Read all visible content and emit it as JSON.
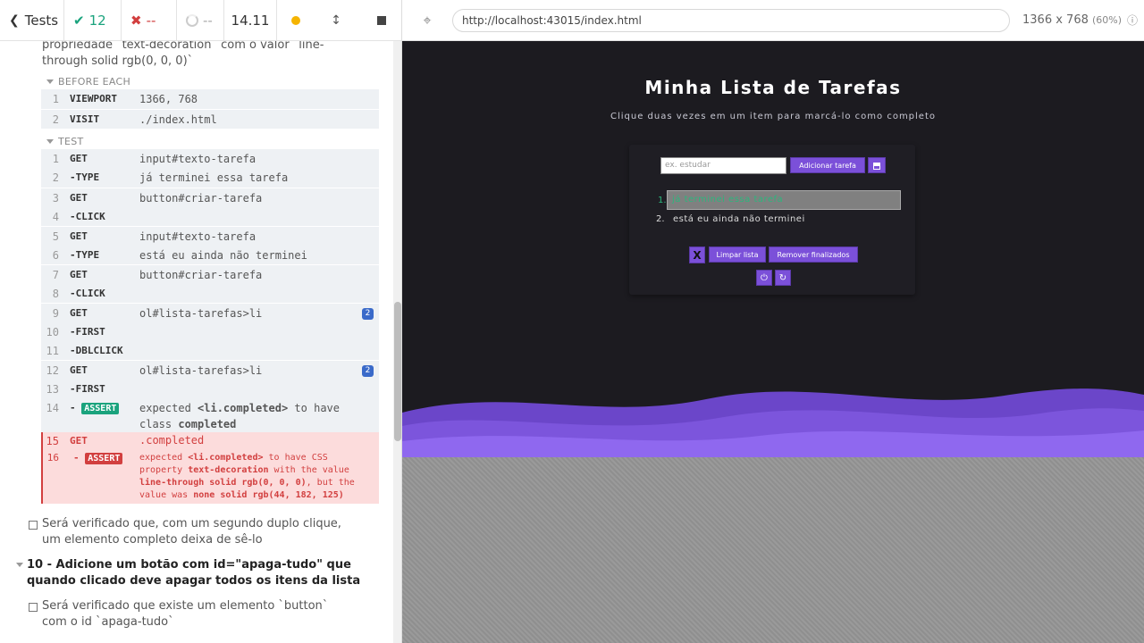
{
  "reporter": {
    "tests_label": "Tests",
    "passed": "12",
    "failed": "--",
    "pending": "--",
    "duration": "14.11",
    "test_title_partial": "propriedade `text-decoration` com o valor `line-through solid rgb(0, 0, 0)`",
    "before_each_label": "BEFORE EACH",
    "test_label": "TEST",
    "before_each_commands": [
      {
        "num": "1",
        "name": "VIEWPORT",
        "msg": "1366, 768"
      },
      {
        "num": "2",
        "name": "VISIT",
        "msg": "./index.html"
      }
    ],
    "test_commands": [
      {
        "num": "1",
        "name": "GET",
        "msg": "input#texto-tarefa"
      },
      {
        "num": "2",
        "name": "-TYPE",
        "msg": "já terminei essa tarefa"
      },
      {
        "num": "3",
        "name": "GET",
        "msg": "button#criar-tarefa"
      },
      {
        "num": "4",
        "name": "-CLICK",
        "msg": ""
      },
      {
        "num": "5",
        "name": "GET",
        "msg": "input#texto-tarefa"
      },
      {
        "num": "6",
        "name": "-TYPE",
        "msg": "está eu ainda não terminei"
      },
      {
        "num": "7",
        "name": "GET",
        "msg": "button#criar-tarefa"
      },
      {
        "num": "8",
        "name": "-CLICK",
        "msg": ""
      },
      {
        "num": "9",
        "name": "GET",
        "msg": "ol#lista-tarefas>li",
        "badge": "2"
      },
      {
        "num": "10",
        "name": "-FIRST",
        "msg": ""
      },
      {
        "num": "11",
        "name": "-DBLCLICK",
        "msg": ""
      },
      {
        "num": "12",
        "name": "GET",
        "msg": "ol#lista-tarefas>li",
        "badge": "2"
      },
      {
        "num": "13",
        "name": "-FIRST",
        "msg": ""
      }
    ],
    "assert_pass": {
      "num": "14",
      "tag": "ASSERT",
      "expected": "expected",
      "subject": "<li.completed>",
      "to_have": "to have",
      "class_word": "class",
      "class_name": "completed"
    },
    "fail_get": {
      "num": "15",
      "name": "GET",
      "msg": ".completed"
    },
    "assert_fail": {
      "num": "16",
      "tag": "ASSERT",
      "p1": "expected",
      "subject": "<li.completed>",
      "p2": "to have CSS property",
      "prop": "text-decoration",
      "p3": "with the value",
      "value": "line-through solid rgb(0, 0, 0)",
      "p4": ", but the value was",
      "actual": "none solid rgb(44, 182, 125)"
    },
    "next_test": "Será verificado que, com um segundo duplo clique, um elemento completo deixa de sê-lo",
    "suite_10": "10 - Adicione um botão com id=\"apaga-tudo\" que quando clicado deve apagar todos os itens da lista",
    "suite_10_test": "Será verificado que existe um elemento `button` com o id `apaga-tudo`"
  },
  "aut_header": {
    "url": "http://localhost:43015/index.html",
    "viewport": "1366 x 768",
    "scale": "(60%)"
  },
  "app": {
    "title": "Minha Lista de Tarefas",
    "subtitle": "Clique duas vezes em um item para marcá-lo como completo",
    "input_placeholder": "ex. estudar",
    "add_button": "Adicionar tarefa",
    "save_icon": "floppy-icon",
    "items": [
      {
        "num": "1.",
        "text": "já terminei essa tarefa"
      },
      {
        "num": "2.",
        "text": "está eu ainda não terminei"
      }
    ],
    "x_button": "X",
    "clear_button": "Limpar lista",
    "remove_done_button": "Remover finalizados",
    "colors": {
      "accent": "#7b50d9",
      "completed_text": "#2cb67d",
      "background": "#1c1b20",
      "pass": "#1aa37d",
      "fail": "#d23f3f"
    }
  }
}
